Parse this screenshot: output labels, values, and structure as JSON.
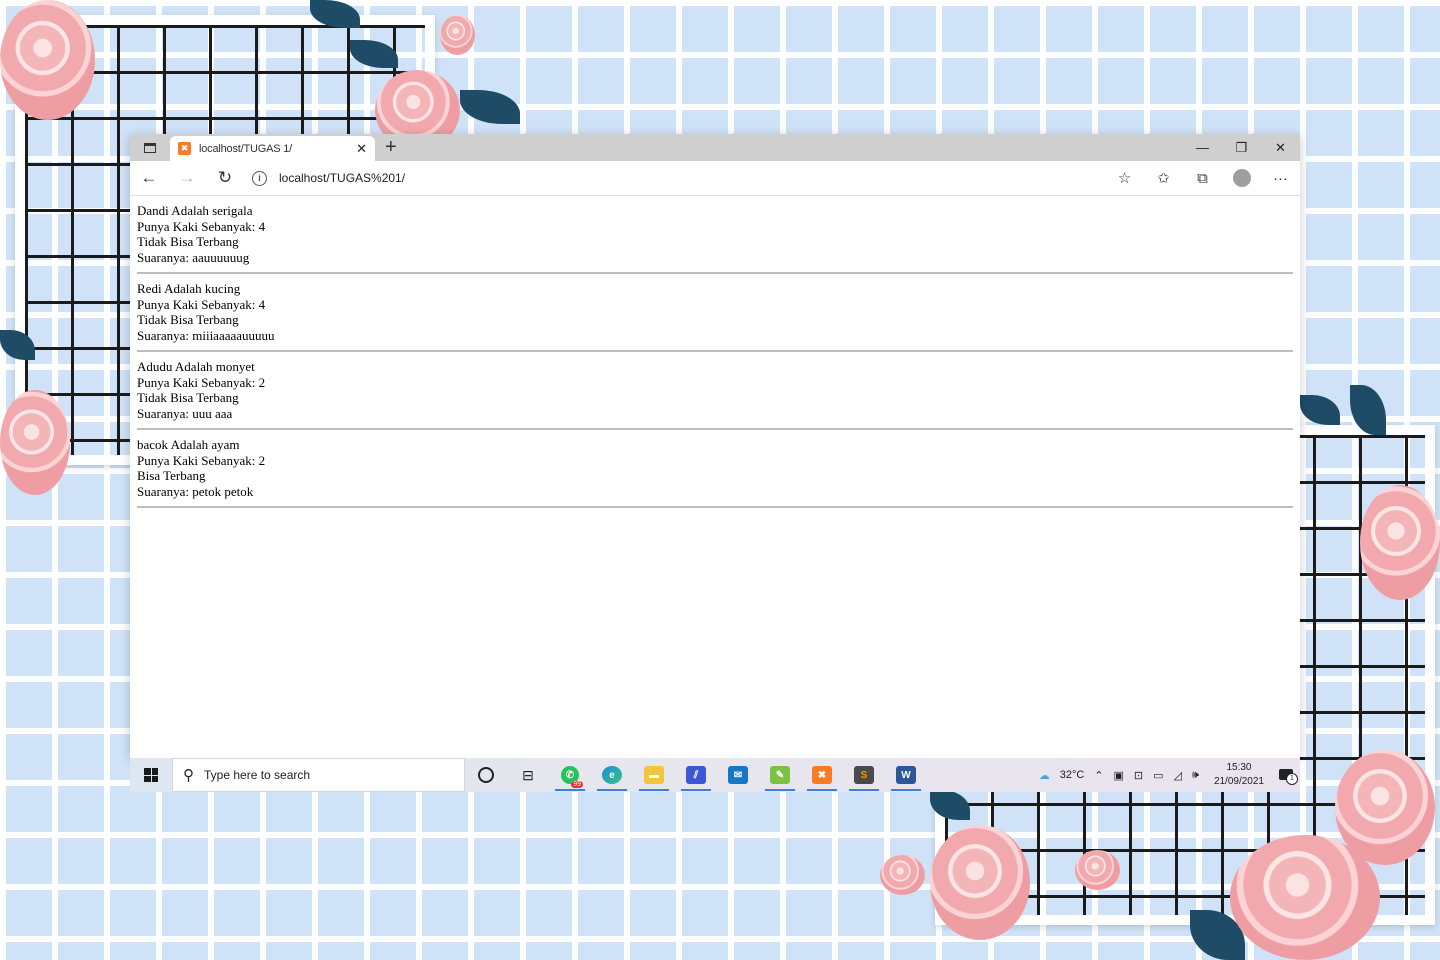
{
  "browser": {
    "tab_title": "localhost/TUGAS 1/",
    "address": "localhost/TUGAS%201/"
  },
  "animals": [
    {
      "name_line": "Dandi Adalah serigala",
      "legs_line": "Punya Kaki Sebanyak: 4",
      "fly_line": "Tidak Bisa Terbang",
      "sound_line": "Suaranya: aauuuuuug"
    },
    {
      "name_line": "Redi Adalah kucing",
      "legs_line": "Punya Kaki Sebanyak: 4",
      "fly_line": "Tidak Bisa Terbang",
      "sound_line": "Suaranya: miiiaaaaauuuuu"
    },
    {
      "name_line": "Adudu Adalah monyet",
      "legs_line": "Punya Kaki Sebanyak: 2",
      "fly_line": "Tidak Bisa Terbang",
      "sound_line": "Suaranya: uuu aaa"
    },
    {
      "name_line": "bacok Adalah ayam",
      "legs_line": "Punya Kaki Sebanyak: 2",
      "fly_line": "Bisa Terbang",
      "sound_line": "Suaranya: petok petok"
    }
  ],
  "taskbar": {
    "search_placeholder": "Type here to search",
    "whatsapp_badge": "99",
    "temperature": "32°C",
    "time": "15:30",
    "date": "21/09/2021",
    "notification_count": "1"
  },
  "icons": [
    "window-square-icon",
    "xampp-icon",
    "close-icon",
    "plus-icon",
    "minimize-icon",
    "restore-icon",
    "back-arrow-icon",
    "forward-arrow-icon",
    "refresh-icon",
    "info-icon",
    "add-favorite-icon",
    "favorites-icon",
    "collections-icon",
    "profile-icon",
    "more-icon",
    "windows-logo-icon",
    "search-icon",
    "cortana-icon",
    "task-view-icon",
    "whatsapp-icon",
    "edge-icon",
    "file-explorer-icon",
    "vscode-icon",
    "mail-icon",
    "notepadpp-icon",
    "xampp-icon",
    "sublime-icon",
    "word-icon",
    "weather-icon",
    "chevron-up-icon",
    "wifi-icon",
    "volume-icon",
    "notification-icon"
  ],
  "colors": {
    "wallpaper": "#cfe2f7",
    "rose": "#f2a9ad",
    "leaf": "#1e4b66",
    "xampp": "#fb7a24",
    "taskbar_accent": "#3b7fd9"
  }
}
